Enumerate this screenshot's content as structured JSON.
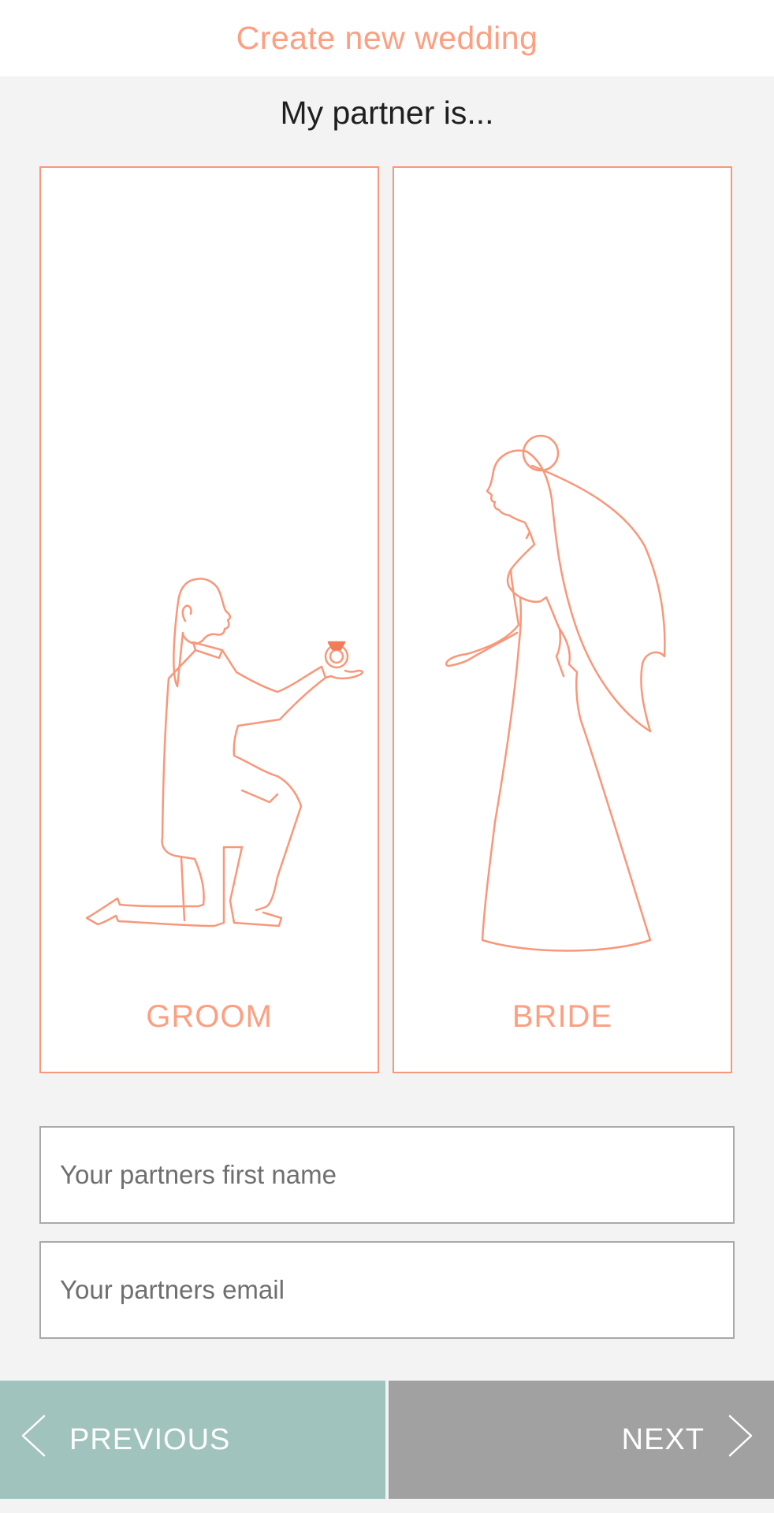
{
  "header": {
    "title": "Create new wedding"
  },
  "prompt": "My partner is...",
  "choices": [
    {
      "label": "GROOM",
      "icon": "kneeling-groom-illustration"
    },
    {
      "label": "BRIDE",
      "icon": "bride-illustration"
    }
  ],
  "form": {
    "first_name_placeholder": "Your partners first name",
    "email_placeholder": "Your partners email",
    "first_name_value": "",
    "email_value": ""
  },
  "nav": {
    "previous_label": "PREVIOUS",
    "next_label": "NEXT"
  },
  "colors": {
    "accent": "#fd9f80",
    "previous_bg": "#a0c3bd",
    "next_bg": "#a1a1a1",
    "page_bg": "#f3f3f3"
  }
}
